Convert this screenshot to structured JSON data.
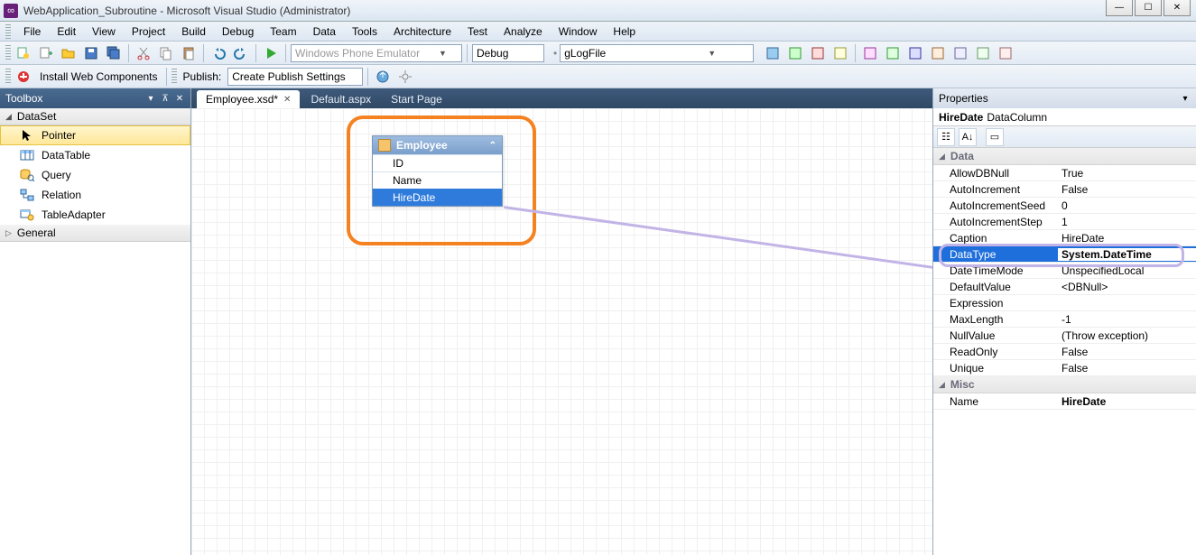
{
  "title": "WebApplication_Subroutine - Microsoft Visual Studio (Administrator)",
  "menu": [
    "File",
    "Edit",
    "View",
    "Project",
    "Build",
    "Debug",
    "Team",
    "Data",
    "Tools",
    "Architecture",
    "Test",
    "Analyze",
    "Window",
    "Help"
  ],
  "toolbar1": {
    "emulator": "Windows Phone Emulator",
    "config": "Debug",
    "find": "gLogFile"
  },
  "toolbar2": {
    "install": "Install Web Components",
    "publish_label": "Publish:",
    "publish_value": "Create Publish Settings"
  },
  "toolbox": {
    "title": "Toolbox",
    "groups": [
      {
        "name": "DataSet",
        "expanded": true,
        "items": [
          {
            "label": "Pointer",
            "icon": "pointer",
            "selected": true
          },
          {
            "label": "DataTable",
            "icon": "datatable"
          },
          {
            "label": "Query",
            "icon": "query"
          },
          {
            "label": "Relation",
            "icon": "relation"
          },
          {
            "label": "TableAdapter",
            "icon": "tableadapter"
          }
        ]
      },
      {
        "name": "General",
        "expanded": false,
        "items": []
      }
    ]
  },
  "tabs": [
    {
      "label": "Employee.xsd*",
      "active": true,
      "closable": true
    },
    {
      "label": "Default.aspx",
      "active": false,
      "closable": false
    },
    {
      "label": "Start Page",
      "active": false,
      "closable": false
    }
  ],
  "entity": {
    "name": "Employee",
    "columns": [
      {
        "name": "ID",
        "selected": false
      },
      {
        "name": "Name",
        "selected": false
      },
      {
        "name": "HireDate",
        "selected": true
      }
    ]
  },
  "properties": {
    "title": "Properties",
    "object_name": "HireDate",
    "object_type": "DataColumn",
    "categories": [
      {
        "name": "Data",
        "rows": [
          {
            "name": "AllowDBNull",
            "value": "True"
          },
          {
            "name": "AutoIncrement",
            "value": "False"
          },
          {
            "name": "AutoIncrementSeed",
            "value": "0"
          },
          {
            "name": "AutoIncrementStep",
            "value": "1"
          },
          {
            "name": "Caption",
            "value": "HireDate"
          },
          {
            "name": "DataType",
            "value": "System.DateTime",
            "selected": true,
            "bold": true
          },
          {
            "name": "DateTimeMode",
            "value": "UnspecifiedLocal"
          },
          {
            "name": "DefaultValue",
            "value": "<DBNull>"
          },
          {
            "name": "Expression",
            "value": ""
          },
          {
            "name": "MaxLength",
            "value": "-1"
          },
          {
            "name": "NullValue",
            "value": "(Throw exception)"
          },
          {
            "name": "ReadOnly",
            "value": "False"
          },
          {
            "name": "Unique",
            "value": "False"
          }
        ]
      },
      {
        "name": "Misc",
        "rows": [
          {
            "name": "Name",
            "value": "HireDate",
            "bold": true
          }
        ]
      }
    ]
  }
}
